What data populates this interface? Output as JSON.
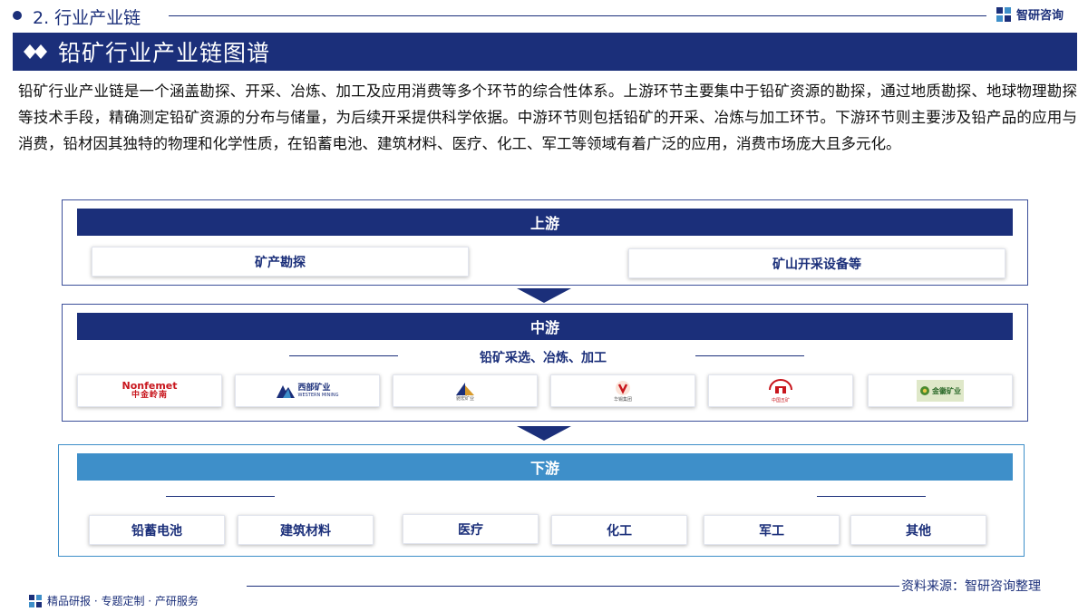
{
  "header": {
    "section_title": "2. 行业产业链",
    "brand_name": "智研咨询"
  },
  "banner": {
    "title": "铅矿行业产业链图谱"
  },
  "intro": "铅矿行业产业链是一个涵盖勘探、开采、冶炼、加工及应用消费等多个环节的综合性体系。上游环节主要集中于铅矿资源的勘探，通过地质勘探、地球物理勘探等技术手段，精确测定铅矿资源的分布与储量，为后续开采提供科学依据。中游环节则包括铅矿的开采、冶炼与加工环节。下游环节则主要涉及铅产品的应用与消费，铅材因其独特的物理和化学性质，在铅蓄电池、建筑材料、医疗、化工、军工等领域有着广泛的应用，消费市场庞大且多元化。",
  "upstream": {
    "title": "上游",
    "items": [
      "矿产勘探",
      "矿山开采设备等"
    ]
  },
  "midstream": {
    "title": "中游",
    "subtitle": "铅矿采选、冶炼、加工",
    "logos": {
      "nonfemet_en": "Nonfemet",
      "nonfemet_cn": "中金岭南",
      "western_cn": "西部矿业",
      "western_en": "WESTERN MINING",
      "logo3_caption": "驰宏矿业",
      "logo4_caption": "华锡集团",
      "logo5_caption": "中国五矿",
      "jinhui_cn": "金徽矿业"
    }
  },
  "downstream": {
    "title": "下游",
    "items": [
      "铅蓄电池",
      "建筑材料",
      "医疗",
      "化工",
      "军工",
      "其他"
    ]
  },
  "source": "资料来源：智研咨询整理",
  "footer": "精品研报 · 专题定制 · 产研服务",
  "colors": {
    "navy": "#1b2f7a",
    "light_blue": "#3e8fc9",
    "red": "#c8161d"
  }
}
